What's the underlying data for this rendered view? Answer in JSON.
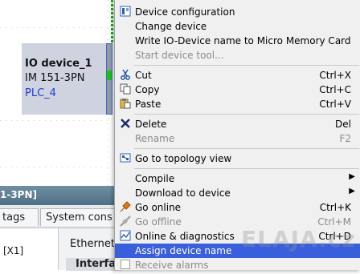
{
  "device": {
    "name": "IO device_1",
    "type": "IM 151-3PN",
    "plc": "PLC_4"
  },
  "inspector": {
    "title": "1-3PN]",
    "tabs": [
      "tags",
      "System cons"
    ],
    "port_label": "[X1]",
    "section": "Ethernet",
    "subsection": "Interfa"
  },
  "menu": {
    "items": [
      {
        "label": "Device configuration",
        "shortcut": "",
        "icon": "device-config-icon",
        "disabled": false
      },
      {
        "label": "Change device",
        "shortcut": "",
        "icon": "",
        "disabled": false
      },
      {
        "label": "Write IO-Device name to Micro Memory Card",
        "shortcut": "",
        "icon": "",
        "disabled": false
      },
      {
        "label": "Start device tool...",
        "shortcut": "",
        "icon": "",
        "disabled": true
      },
      {
        "label": "Cut",
        "shortcut": "Ctrl+X",
        "icon": "scissors-icon",
        "disabled": false
      },
      {
        "label": "Copy",
        "shortcut": "Ctrl+C",
        "icon": "copy-icon",
        "disabled": false
      },
      {
        "label": "Paste",
        "shortcut": "Ctrl+V",
        "icon": "paste-icon",
        "disabled": false
      },
      {
        "label": "Delete",
        "shortcut": "Del",
        "icon": "delete-x-icon",
        "disabled": false
      },
      {
        "label": "Rename",
        "shortcut": "F2",
        "icon": "",
        "disabled": true
      },
      {
        "label": "Go to topology view",
        "shortcut": "",
        "icon": "topology-icon",
        "disabled": false
      },
      {
        "label": "Compile",
        "shortcut": "",
        "icon": "",
        "disabled": false,
        "submenu": true
      },
      {
        "label": "Download to device",
        "shortcut": "",
        "icon": "",
        "disabled": false,
        "submenu": true
      },
      {
        "label": "Go online",
        "shortcut": "Ctrl+K",
        "icon": "go-online-icon",
        "disabled": false
      },
      {
        "label": "Go offline",
        "shortcut": "Ctrl+M",
        "icon": "go-offline-icon",
        "disabled": true
      },
      {
        "label": "Online & diagnostics",
        "shortcut": "Ctrl+D",
        "icon": "diagnostics-icon",
        "disabled": false
      },
      {
        "label": "Assign device name",
        "shortcut": "",
        "icon": "",
        "disabled": false,
        "selected": true
      },
      {
        "label": "Receive alarms",
        "shortcut": "",
        "icon": "checkbox-icon",
        "disabled": true
      }
    ]
  },
  "watermark": "ELAJA.cz",
  "colors": {
    "selection": "#3a5fdc",
    "device_box": "#cfd3e0",
    "plc_link": "#1a3ed8",
    "port_green": "#13c613",
    "inspector_header": "#5f7f94"
  }
}
